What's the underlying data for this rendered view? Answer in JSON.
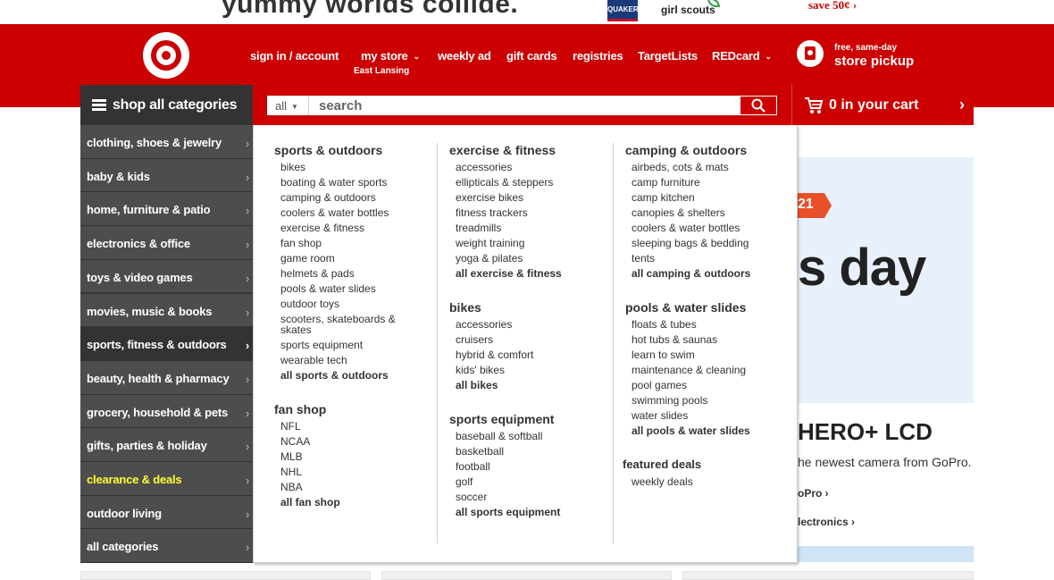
{
  "promo": {
    "headline": "yummy worlds collide.",
    "quaker": "QUAKER",
    "girl_scouts": "girl scouts",
    "save": "save 50¢ ›"
  },
  "header": {
    "nav": {
      "signin": "sign in / account",
      "my_store": "my store",
      "store_name": "East Lansing",
      "weekly_ad": "weekly ad",
      "gift_cards": "gift cards",
      "registries": "registries",
      "target_lists": "TargetLists",
      "redcard": "REDcard"
    },
    "pickup": {
      "small": "free, same-day",
      "big": "store pickup"
    }
  },
  "shop_all": {
    "label": "shop all categories"
  },
  "search": {
    "dept": "all",
    "placeholder": "search"
  },
  "cart": {
    "label": "0 in your cart"
  },
  "categories": [
    {
      "label": "clothing, shoes & jewelry"
    },
    {
      "label": "baby & kids"
    },
    {
      "label": "home, furniture & patio"
    },
    {
      "label": "electronics & office"
    },
    {
      "label": "toys & video games"
    },
    {
      "label": "movies, music & books"
    },
    {
      "label": "sports, fitness & outdoors"
    },
    {
      "label": "beauty, health & pharmacy"
    },
    {
      "label": "grocery, household & pets"
    },
    {
      "label": "gifts, parties & holiday"
    },
    {
      "label": "clearance & deals"
    },
    {
      "label": "outdoor living"
    },
    {
      "label": "all categories"
    }
  ],
  "flyout": {
    "col1": {
      "sports_outdoors": {
        "heading": "sports & outdoors",
        "items": [
          "bikes",
          "boating & water sports",
          "camping & outdoors",
          "coolers & water bottles",
          "exercise & fitness",
          "fan shop",
          "game room",
          "helmets & pads",
          "pools & water slides",
          "outdoor toys",
          "scooters, skateboards &",
          "skates",
          "sports equipment",
          "wearable tech"
        ],
        "all": "all sports & outdoors"
      },
      "fan_shop": {
        "heading": "fan shop",
        "items": [
          "NFL",
          "NCAA",
          "MLB",
          "NHL",
          "NBA"
        ],
        "all": "all fan shop"
      }
    },
    "col2": {
      "exercise": {
        "heading": "exercise & fitness",
        "items": [
          "accessories",
          "ellipticals & steppers",
          "exercise bikes",
          "fitness trackers",
          "treadmills",
          "weight training",
          "yoga & pilates"
        ],
        "all": "all exercise & fitness"
      },
      "bikes": {
        "heading": "bikes",
        "items": [
          "accessories",
          "cruisers",
          "hybrid & comfort",
          "kids' bikes"
        ],
        "all": "all bikes"
      },
      "sports_equipment": {
        "heading": "sports equipment",
        "items": [
          "baseball & softball",
          "basketball",
          "football",
          "golf",
          "soccer"
        ],
        "all": "all sports equipment"
      }
    },
    "col3": {
      "camping": {
        "heading": "camping & outdoors",
        "items": [
          "airbeds, cots & mats",
          "camp furniture",
          "camp kitchen",
          "canopies & shelters",
          "coolers & water bottles",
          "sleeping bags & bedding",
          "tents"
        ],
        "all": "all camping & outdoors"
      },
      "pools": {
        "heading": "pools & water slides",
        "items": [
          "floats & tubes",
          "hot tubs & saunas",
          "learn to swim",
          "maintenance & cleaning",
          "pool games",
          "swimming pools",
          "water slides"
        ],
        "all": "all pools & water slides"
      },
      "featured": {
        "heading": "featured deals",
        "items": [
          "weekly deals"
        ]
      }
    }
  },
  "hero": {
    "tag": "21",
    "day": "s day",
    "title": "HERO+ LCD",
    "desc": "he newest camera from GoPro.",
    "link1": "oPro ›",
    "link2": "lectronics ›"
  },
  "colors": {
    "brand_red": "#cc0000",
    "dark": "#333333",
    "deal_yellow": "#ffff33"
  }
}
